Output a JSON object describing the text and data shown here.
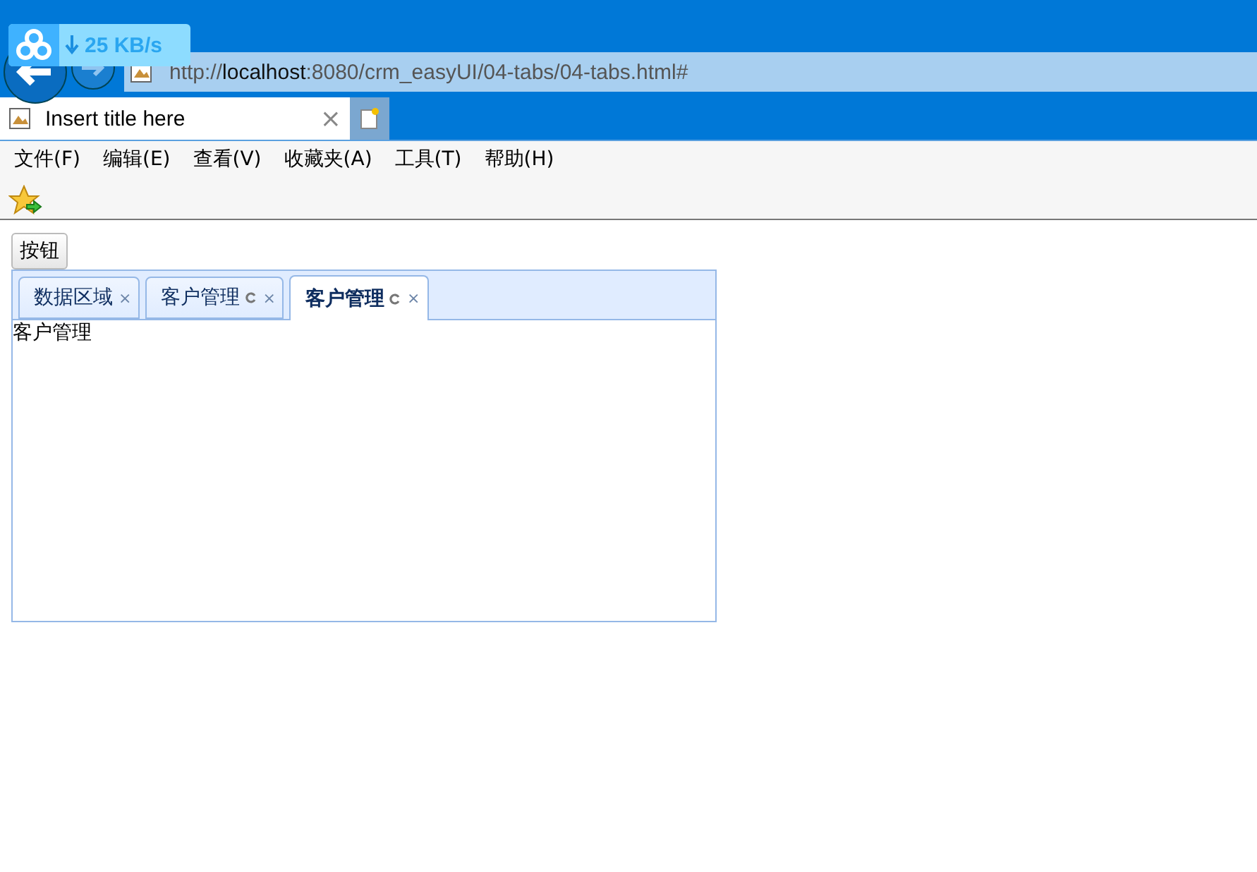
{
  "download_widget": {
    "speed": "25 KB/s"
  },
  "address_bar": {
    "scheme": "http://",
    "host": "localhost",
    "rest": ":8080/crm_easyUI/04-tabs/04-tabs.html#"
  },
  "browser_tab": {
    "title": "Insert title here",
    "close": "×"
  },
  "menu": [
    "文件(F)",
    "编辑(E)",
    "查看(V)",
    "收藏夹(A)",
    "工具(T)",
    "帮助(H)"
  ],
  "page": {
    "button": "按钮",
    "tabs": [
      {
        "label": "数据区域",
        "selected": false,
        "refreshable": false,
        "close": "×"
      },
      {
        "label": "客户管理",
        "selected": false,
        "refreshable": true,
        "close": "×"
      },
      {
        "label": "客户管理",
        "selected": true,
        "refreshable": true,
        "close": "×"
      }
    ],
    "panel_text": "客户管理"
  }
}
